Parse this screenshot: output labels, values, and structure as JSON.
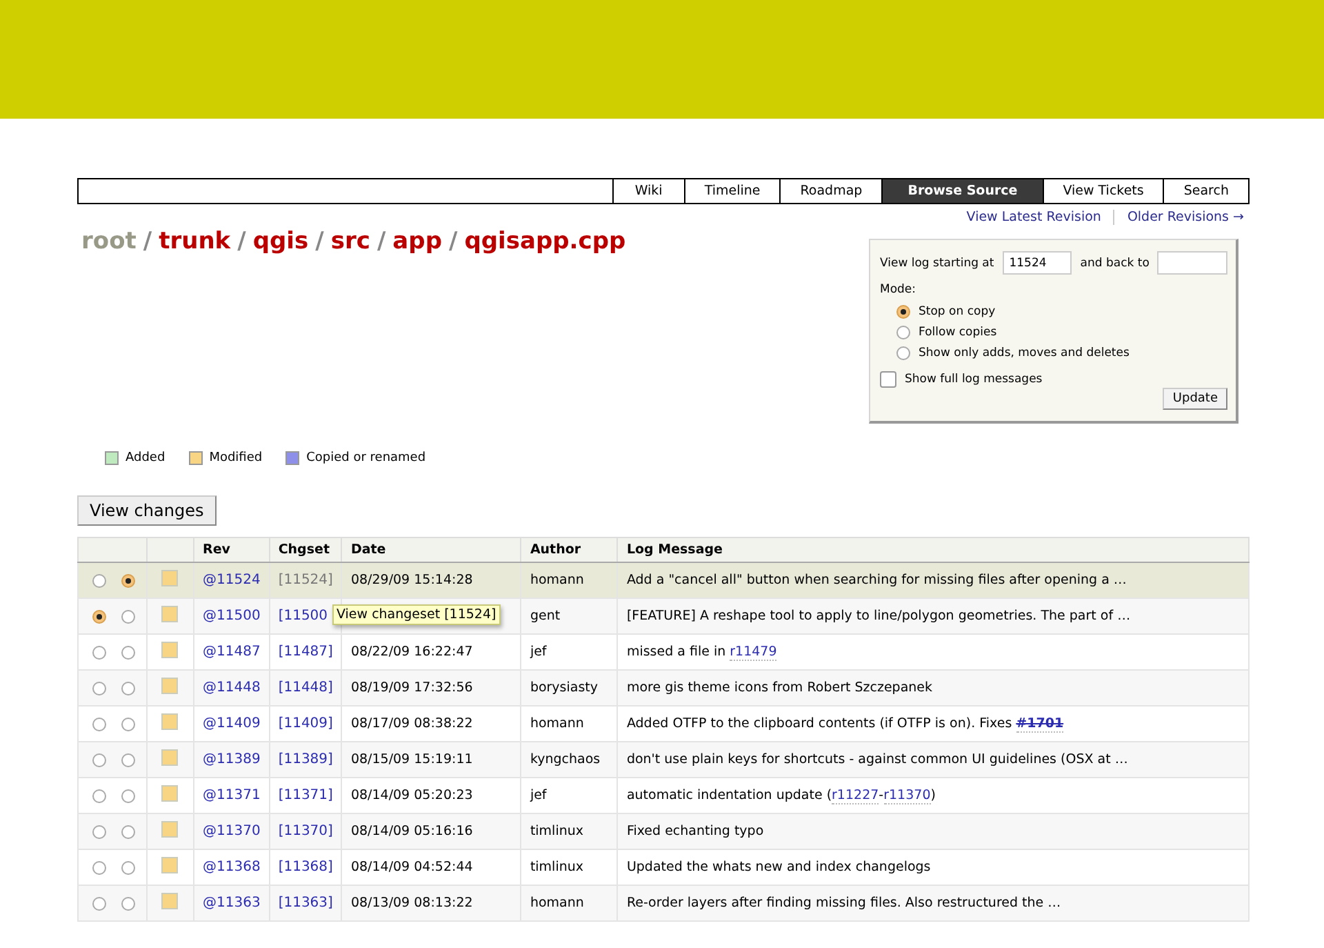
{
  "nav": [
    {
      "label": "Wiki",
      "selected": false
    },
    {
      "label": "Timeline",
      "selected": false
    },
    {
      "label": "Roadmap",
      "selected": false
    },
    {
      "label": "Browse Source",
      "selected": true
    },
    {
      "label": "View Tickets",
      "selected": false
    },
    {
      "label": "Search",
      "selected": false
    }
  ],
  "context_links": [
    "View Latest Revision",
    "Older Revisions →"
  ],
  "path": [
    "root",
    "trunk",
    "qgis",
    "src",
    "app",
    "qgisapp.cpp"
  ],
  "path_separator": "/",
  "log_form": {
    "start_label": "View log starting at",
    "start_value": "11524",
    "back_label": "and back to",
    "mode_label": "Mode:",
    "modes": [
      {
        "label": "Stop on copy",
        "selected": true
      },
      {
        "label": "Follow copies",
        "selected": false
      },
      {
        "label": "Show only adds, moves and deletes",
        "selected": false
      }
    ],
    "full_log": {
      "label": "Show full log messages",
      "checked": false
    },
    "update": "Update"
  },
  "legend": [
    {
      "label": "Added",
      "color": "#bfe9bf"
    },
    {
      "label": "Modified",
      "color": "#f7d585"
    },
    {
      "label": "Copied or renamed",
      "color": "#8e8fe8"
    }
  ],
  "view_changes": "View changes",
  "columns": [
    "Rev",
    "Chgset",
    "Date",
    "Author",
    "Log Message"
  ],
  "rows": [
    {
      "selected": true,
      "radios": [
        false,
        true
      ],
      "color": "#f7d585",
      "rev": "@11524",
      "chgset": "[11524]",
      "chgset_visited": true,
      "date": "08/29/09 15:14:28",
      "author": "homann",
      "message": [
        {
          "kind": "text",
          "text": "Add a \"cancel all\" button when searching for missing files after opening a …"
        }
      ]
    },
    {
      "selected": false,
      "radios": [
        true,
        false
      ],
      "color": "#f7d585",
      "rev": "@11500",
      "chgset": "[11500",
      "chgset_visited": false,
      "author": "gent",
      "message": [
        {
          "kind": "text",
          "text": "[FEATURE] A reshape tool to apply to line/polygon geometries. The part of …"
        }
      ]
    },
    {
      "selected": false,
      "radios": [
        false,
        false
      ],
      "color": "#f7d585",
      "rev": "@11487",
      "chgset": "[11487]",
      "chgset_visited": false,
      "date": "08/22/09 16:22:47",
      "author": "jef",
      "message": [
        {
          "kind": "text",
          "text": "missed a file in "
        },
        {
          "kind": "link",
          "text": "r11479"
        }
      ]
    },
    {
      "selected": false,
      "radios": [
        false,
        false
      ],
      "color": "#f7d585",
      "rev": "@11448",
      "chgset": "[11448]",
      "chgset_visited": false,
      "date": "08/19/09 17:32:56",
      "author": "borysiasty",
      "message": [
        {
          "kind": "text",
          "text": "more gis theme icons from Robert Szczepanek"
        }
      ]
    },
    {
      "selected": false,
      "radios": [
        false,
        false
      ],
      "color": "#f7d585",
      "rev": "@11409",
      "chgset": "[11409]",
      "chgset_visited": false,
      "date": "08/17/09 08:38:22",
      "author": "homann",
      "message": [
        {
          "kind": "text",
          "text": "Added OTFP to the clipboard contents (if OTFP is on). Fixes "
        },
        {
          "kind": "closed_ticket",
          "text": "#1701"
        }
      ]
    },
    {
      "selected": false,
      "radios": [
        false,
        false
      ],
      "color": "#f7d585",
      "rev": "@11389",
      "chgset": "[11389]",
      "chgset_visited": false,
      "date": "08/15/09 15:19:11",
      "author": "kyngchaos",
      "message": [
        {
          "kind": "text",
          "text": "don't use plain keys for shortcuts - against common UI guidelines (OSX at …"
        }
      ]
    },
    {
      "selected": false,
      "radios": [
        false,
        false
      ],
      "color": "#f7d585",
      "rev": "@11371",
      "chgset": "[11371]",
      "chgset_visited": false,
      "date": "08/14/09 05:20:23",
      "author": "jef",
      "message": [
        {
          "kind": "text",
          "text": "automatic indentation update ("
        },
        {
          "kind": "link",
          "text": "r11227"
        },
        {
          "kind": "text",
          "text": "-"
        },
        {
          "kind": "link",
          "text": "r11370"
        },
        {
          "kind": "text",
          "text": ")"
        }
      ]
    },
    {
      "selected": false,
      "radios": [
        false,
        false
      ],
      "color": "#f7d585",
      "rev": "@11370",
      "chgset": "[11370]",
      "chgset_visited": false,
      "date": "08/14/09 05:16:16",
      "author": "timlinux",
      "message": [
        {
          "kind": "text",
          "text": "Fixed echanting typo"
        }
      ]
    },
    {
      "selected": false,
      "radios": [
        false,
        false
      ],
      "color": "#f7d585",
      "rev": "@11368",
      "chgset": "[11368]",
      "chgset_visited": false,
      "date": "08/14/09 04:52:44",
      "author": "timlinux",
      "message": [
        {
          "kind": "text",
          "text": "Updated the whats new and index changelogs"
        }
      ]
    },
    {
      "selected": false,
      "radios": [
        false,
        false
      ],
      "color": "#f7d585",
      "rev": "@11363",
      "chgset": "[11363]",
      "chgset_visited": false,
      "date": "08/13/09 08:13:22",
      "author": "homann",
      "message": [
        {
          "kind": "text",
          "text": "Re-order layers after finding missing files. Also restructured the …"
        }
      ]
    }
  ],
  "tooltip": "View changeset [11524]"
}
